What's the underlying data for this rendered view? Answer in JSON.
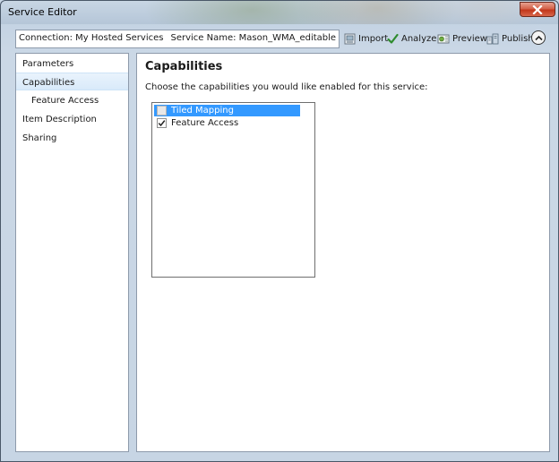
{
  "window": {
    "title": "Service Editor"
  },
  "toolbar": {
    "connection": "Connection: My Hosted Services",
    "service_name": "Service Name: Mason_WMA_editable",
    "import_label": "Import",
    "analyze_label": "Analyze",
    "preview_label": "Preview",
    "publish_label": "Publish"
  },
  "nav": {
    "items": [
      {
        "label": "Parameters"
      },
      {
        "label": "Capabilities"
      },
      {
        "label": "Feature Access"
      },
      {
        "label": "Item Description"
      },
      {
        "label": "Sharing"
      }
    ],
    "selected": "Capabilities"
  },
  "content": {
    "heading": "Capabilities",
    "instruction": "Choose the capabilities you would like enabled for this service:",
    "capabilities": [
      {
        "label": "Tiled Mapping",
        "checked": false,
        "enabled": false,
        "highlighted": true
      },
      {
        "label": "Feature Access",
        "checked": true,
        "enabled": true,
        "highlighted": false
      }
    ]
  },
  "colors": {
    "selection": "#3399ff",
    "close_button": "#c2371c",
    "nav_selected": "#d9eafa"
  }
}
